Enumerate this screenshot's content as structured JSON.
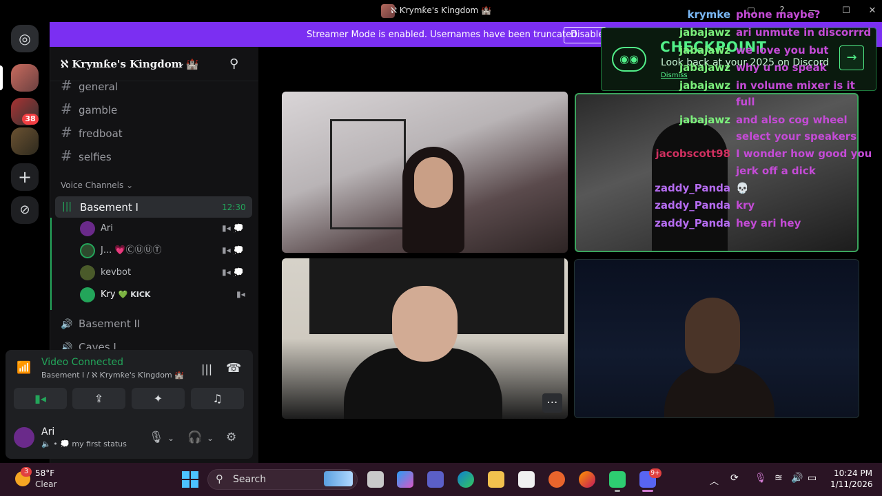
{
  "window": {
    "title": "ℵ Ƙrymƙe's Ƙingdom 🏰"
  },
  "streamer_banner": {
    "text": "Streamer Mode is enabled. Usernames have been truncated.",
    "disable_label": "Disable"
  },
  "server_rail": {
    "badge_count": "38"
  },
  "server": {
    "name": "ℵ Ƙrymƙe's Ƙingdom 🏰"
  },
  "channels": {
    "text": [
      {
        "label": "general"
      },
      {
        "label": "gamble"
      },
      {
        "label": "fredboat"
      },
      {
        "label": "selfies"
      }
    ],
    "voice_header": "Voice Channels",
    "voice": [
      {
        "label": "Basement I",
        "timer": "12:30"
      },
      {
        "label": "Basement II"
      },
      {
        "label": "Caves I"
      }
    ],
    "members": [
      {
        "name": "Ari",
        "tag": ""
      },
      {
        "name": "J...",
        "tag": "💗ⒸⓊⓊⓉ"
      },
      {
        "name": "kevbot",
        "tag": ""
      },
      {
        "name": "Kry",
        "tag": "💚 KICK"
      }
    ]
  },
  "voice_panel": {
    "status": "Video Connected",
    "subtitle": "Basement I / ℵ Ƙrymƙe's Ƙingdom 🏰"
  },
  "user": {
    "name": "Ari",
    "status": "my first status"
  },
  "checkpoint": {
    "title": "CHECKPOINT",
    "subtitle": "Look back at your 2025 on Discord",
    "dismiss": "Dismiss"
  },
  "chat": [
    {
      "user": "krymke",
      "msg": "phone maybe?"
    },
    {
      "user": "jabajawz",
      "msg": "ari unmute in discorrrd"
    },
    {
      "user": "jabajawz",
      "msg": "we love you but"
    },
    {
      "user": "jabajawz",
      "msg": "why u no speak"
    },
    {
      "user": "jabajawz",
      "msg": "in volume mixer is it"
    },
    {
      "user": "",
      "msg": "full"
    },
    {
      "user": "jabajawz",
      "msg": "and also cog wheel"
    },
    {
      "user": "",
      "msg": "select your speakers"
    },
    {
      "user": "jacobscott98",
      "msg": "I wonder how good you"
    },
    {
      "user": "",
      "msg": "jerk off a dick"
    },
    {
      "user": "zaddy_Panda",
      "msg": "💀"
    },
    {
      "user": "zaddy_Panda",
      "msg": "kry"
    },
    {
      "user": "zaddy_Panda",
      "msg": "hey ari hey"
    }
  ],
  "taskbar": {
    "weather_temp": "58°F",
    "weather_desc": "Clear",
    "weather_badge": "3",
    "search_label": "Search",
    "discord_badge": "9+",
    "time": "10:24 PM",
    "date": "1/11/2026"
  },
  "colors": {
    "accent": "#7b2ff2",
    "voice_green": "#23a55a",
    "chat_user": "#7cf07c",
    "chat_msg": "#c44bd6"
  }
}
